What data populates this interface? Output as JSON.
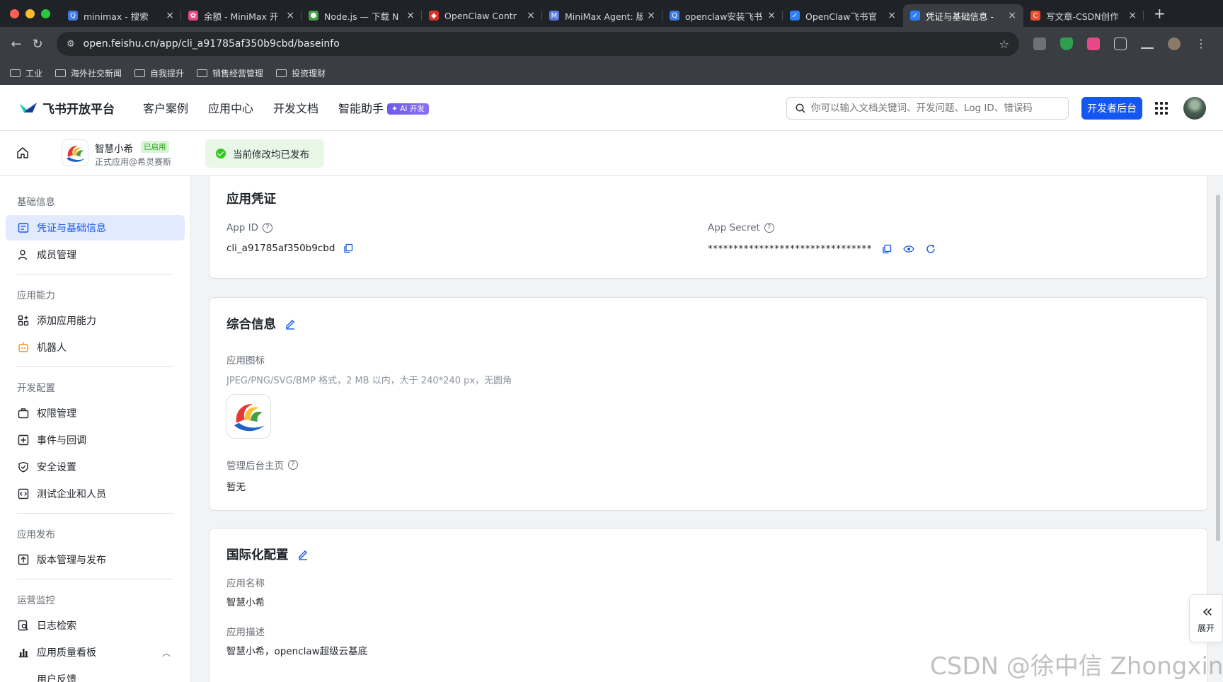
{
  "browser": {
    "tabs": [
      {
        "title": "minimax - 搜索",
        "color": "#3f7ae0",
        "glyph": "Q"
      },
      {
        "title": "余额 - MiniMax 开",
        "color": "#e8488a",
        "glyph": "✿"
      },
      {
        "title": "Node.js — 下载 N",
        "color": "#43a047",
        "glyph": "⬢"
      },
      {
        "title": "OpenClaw Contr",
        "color": "#d6342b",
        "glyph": "◆"
      },
      {
        "title": "MiniMax Agent: 版",
        "color": "#5a7bd8",
        "glyph": "M"
      },
      {
        "title": "openclaw安装飞书",
        "color": "#3f7ae0",
        "glyph": "Q"
      },
      {
        "title": "OpenClaw飞书官",
        "color": "#2d7ef7",
        "glyph": "✓"
      },
      {
        "title": "凭证与基础信息 - ",
        "color": "#2d7ef7",
        "glyph": "✓"
      },
      {
        "title": "写文章-CSDN创作",
        "color": "#f04a2f",
        "glyph": "C"
      }
    ],
    "active_tab": 7,
    "url": "open.feishu.cn/app/cli_a91785af350b9cbd/baseinfo",
    "bookmarks": [
      "工业",
      "海外社交新闻",
      "自我提升",
      "销售经营管理",
      "投资理财"
    ]
  },
  "header": {
    "logo": "飞书开放平台",
    "nav": [
      "客户案例",
      "应用中心",
      "开发文档",
      "智能助手"
    ],
    "ai_badge": "✦ AI 开发",
    "search_placeholder": "你可以输入文档关键词、开发问题、Log ID、错误码",
    "dev_button": "开发者后台"
  },
  "appbar": {
    "app_name": "智慧小希",
    "status": "已启用",
    "subtitle": "正式应用@希灵赛斯",
    "publish_notice": "当前修改均已发布"
  },
  "sidebar": {
    "groups": [
      "基础信息",
      "应用能力",
      "开发配置",
      "应用发布",
      "运营监控"
    ],
    "items": [
      "凭证与基础信息",
      "成员管理",
      "添加应用能力",
      "机器人",
      "权限管理",
      "事件与回调",
      "安全设置",
      "测试企业和人员",
      "版本管理与发布",
      "日志检索",
      "应用质量看板",
      "用户反馈"
    ]
  },
  "credentials": {
    "title": "应用凭证",
    "app_id_label": "App ID",
    "app_id": "cli_a91785af350b9cbd",
    "app_secret_label": "App Secret",
    "app_secret": "********************************"
  },
  "general": {
    "title": "综合信息",
    "icon_label": "应用图标",
    "icon_hint": "JPEG/PNG/SVG/BMP 格式，2 MB 以内，大于 240*240 px，无圆角",
    "homepage_label": "管理后台主页",
    "homepage_value": "暂无"
  },
  "i18n": {
    "title": "国际化配置",
    "name_label": "应用名称",
    "name_value": "智慧小希",
    "desc_label": "应用描述",
    "desc_value": "智慧小希，openclaw超级云基底"
  },
  "expand_label": "展开",
  "watermark": "CSDN @徐中信 Zhongxin Xu"
}
